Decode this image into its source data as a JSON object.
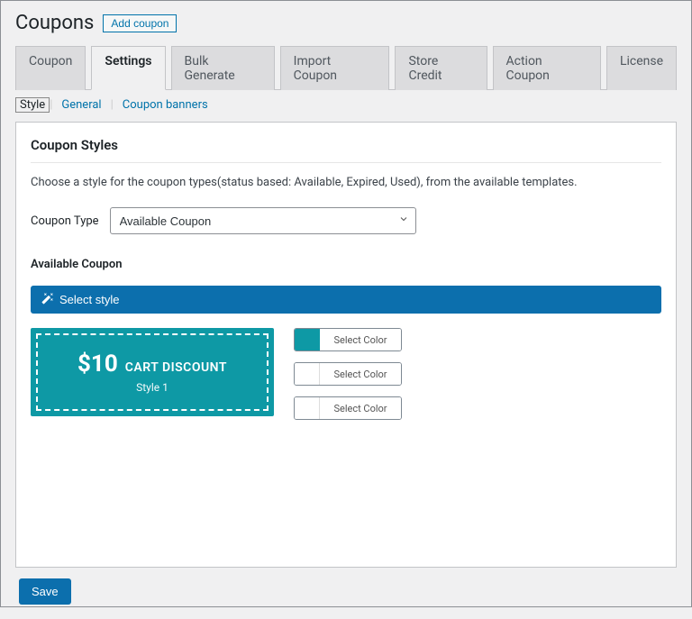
{
  "header": {
    "title": "Coupons",
    "add_button": "Add coupon"
  },
  "tabs": [
    {
      "label": "Coupon"
    },
    {
      "label": "Settings"
    },
    {
      "label": "Bulk Generate"
    },
    {
      "label": "Import Coupon"
    },
    {
      "label": "Store Credit"
    },
    {
      "label": "Action Coupon"
    },
    {
      "label": "License"
    }
  ],
  "subtabs": [
    {
      "label": "Style"
    },
    {
      "label": "General"
    },
    {
      "label": "Coupon banners"
    }
  ],
  "panel": {
    "heading": "Coupon Styles",
    "description": "Choose a style for the coupon types(status based: Available, Expired, Used), from the available templates.",
    "coupon_type_label": "Coupon Type",
    "coupon_type_value": "Available Coupon",
    "section_heading": "Available Coupon",
    "select_style_btn": "Select style",
    "preview": {
      "amount": "$10",
      "label": "CART DISCOUNT",
      "style_name": "Style 1"
    },
    "colors": {
      "teal": "#0e99a5",
      "white": "#ffffff",
      "select_color_label": "Select Color"
    },
    "save_btn": "Save"
  }
}
